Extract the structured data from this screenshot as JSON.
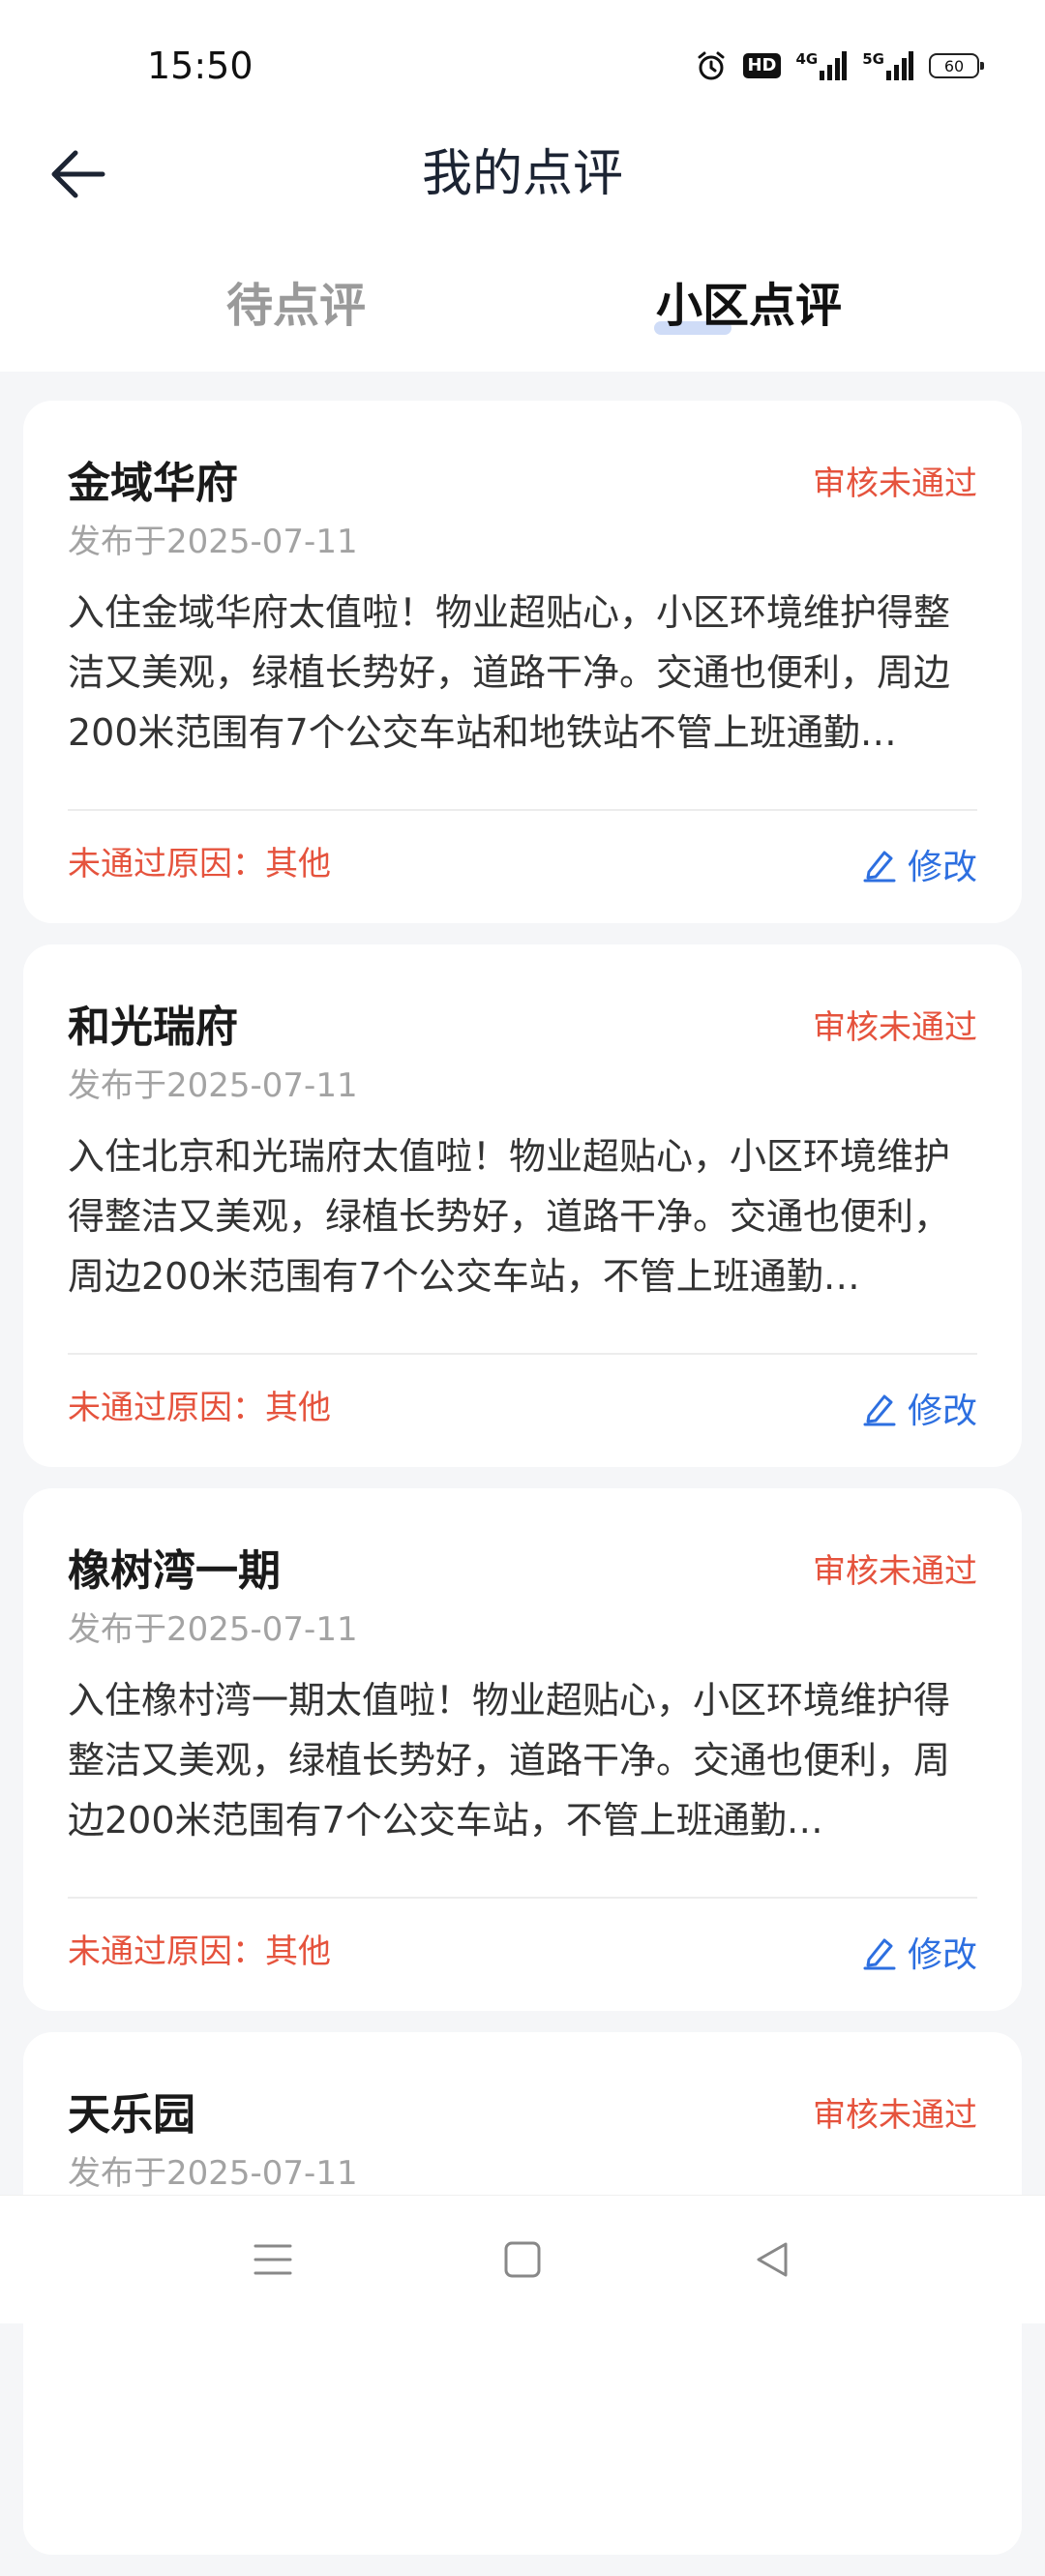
{
  "status_bar": {
    "time": "15:50",
    "hd_label": "HD",
    "net1": "4G",
    "net2": "5G",
    "battery": "60"
  },
  "header": {
    "title": "我的点评"
  },
  "tabs": [
    {
      "label": "待点评",
      "active": false
    },
    {
      "label": "小区点评",
      "active": true
    }
  ],
  "reviews": [
    {
      "name": "金域华府",
      "status": "审核未通过",
      "date": "发布于2025-07-11",
      "content": "入住金域华府太值啦！物业超贴心，小区环境维护得整洁又美观，绿植长势好，道路干净。交通也便利，周边200米范围有7个公交车站和地铁站不管上班通勤…",
      "reason": "未通过原因：其他",
      "action": "修改"
    },
    {
      "name": "和光瑞府",
      "status": "审核未通过",
      "date": "发布于2025-07-11",
      "content": "入住北京和光瑞府太值啦！物业超贴心，小区环境维护得整洁又美观，绿植长势好，道路干净。交通也便利，周边200米范围有7个公交车站，不管上班通勤…",
      "reason": "未通过原因：其他",
      "action": "修改"
    },
    {
      "name": "橡树湾一期",
      "status": "审核未通过",
      "date": "发布于2025-07-11",
      "content": "入住橡村湾一期太值啦！物业超贴心，小区环境维护得整洁又美观，绿植长势好，道路干净。交通也便利，周边200米范围有7个公交车站，不管上班通勤…",
      "reason": "未通过原因：其他",
      "action": "修改"
    },
    {
      "name": "天乐园",
      "status": "审核未通过",
      "date": "发布于2025-07-11",
      "content": "",
      "reason": "",
      "action": ""
    }
  ],
  "colors": {
    "reject": "#e5533d",
    "link": "#2d6fe0",
    "tab_indicator": "#cfdcf7"
  }
}
